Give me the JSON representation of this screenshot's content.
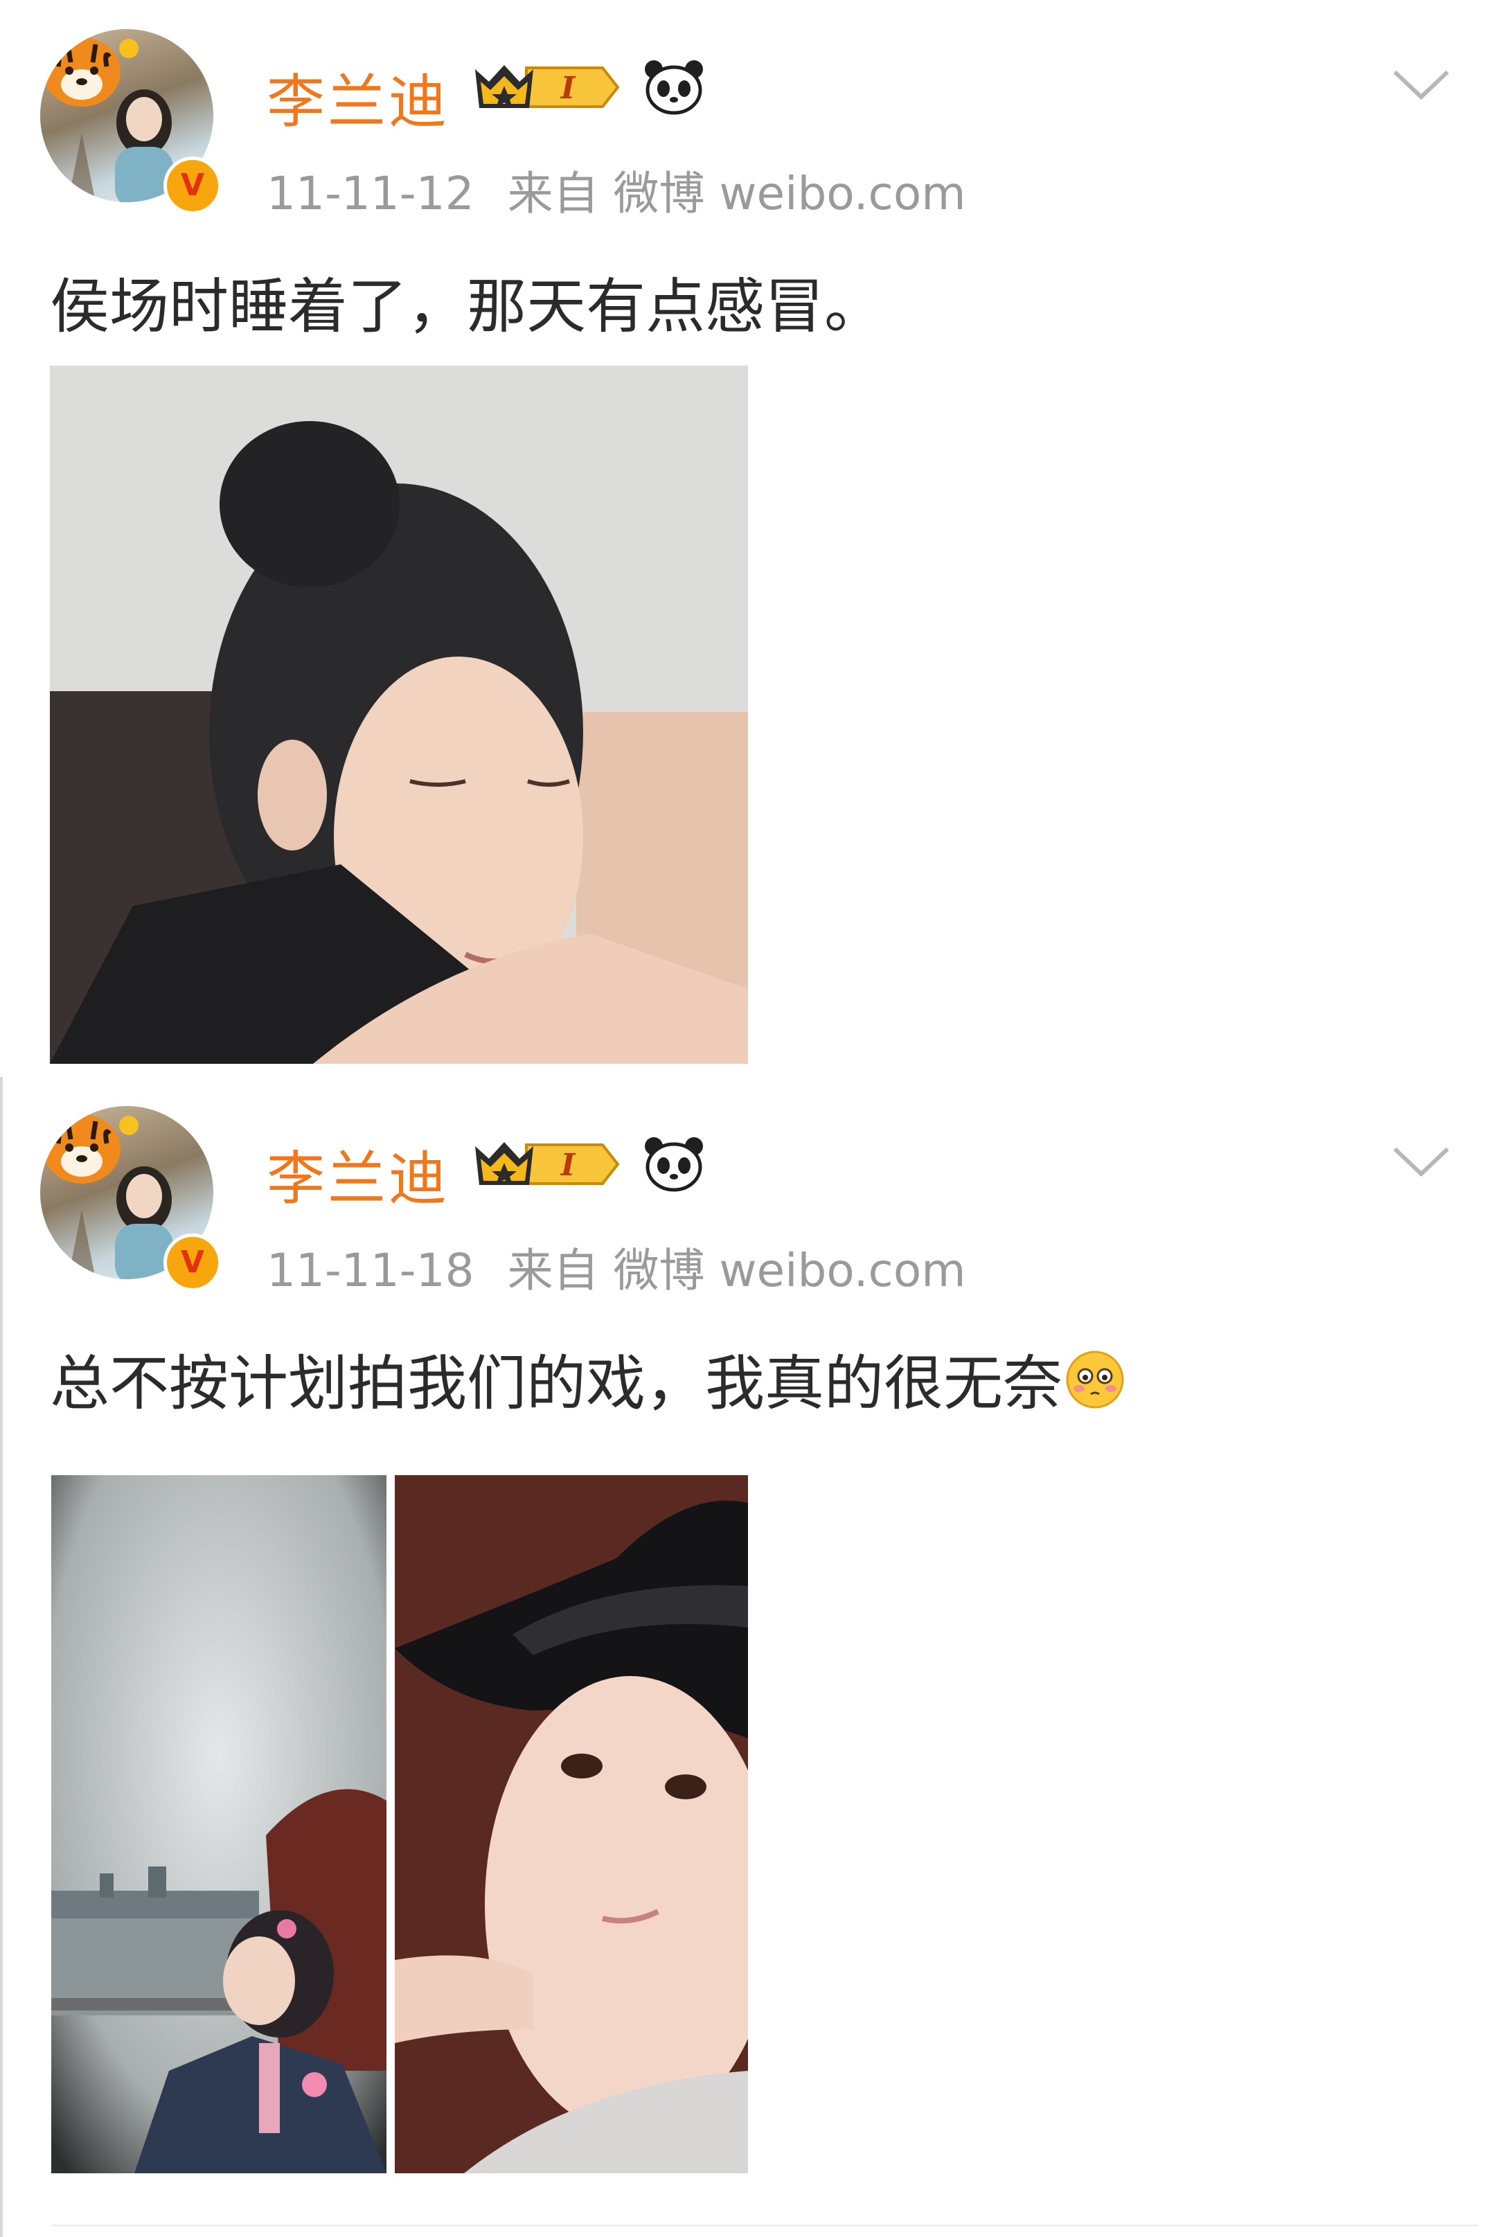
{
  "posts": [
    {
      "username": "李兰迪",
      "vip_level": "I",
      "verified_badge": "V",
      "date": "11-11-12",
      "source": "来自 微博 weibo.com",
      "text": "侯场时睡着了，那天有点感冒。",
      "images": [
        "sleeping-girl-photo"
      ]
    },
    {
      "username": "李兰迪",
      "vip_level": "I",
      "verified_badge": "V",
      "date": "11-11-18",
      "source": "来自 微博 weibo.com",
      "text": "总不按计划拍我们的戏，我真的很无奈",
      "emoji": "flushed-face",
      "images": [
        "girl-by-river-photo",
        "girl-in-black-hat-photo"
      ]
    }
  ],
  "colors": {
    "username": "#f0771c",
    "meta": "#9a9a9a",
    "text": "#2b2b2b",
    "verified": "#f7a60e",
    "crown_gold": "#f5b81a"
  }
}
